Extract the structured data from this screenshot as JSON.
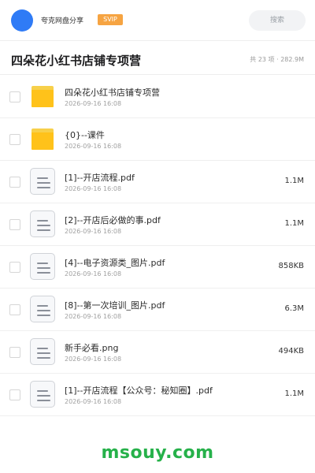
{
  "header": {
    "share_name": "夸克网盘分享",
    "badge": "SVIP",
    "search_placeholder": "搜索"
  },
  "folder": {
    "title": "四朵花小红书店铺专项营",
    "stats": "共 23 项 · 282.9M"
  },
  "files": [
    {
      "name": "四朵花小红书店铺专项营",
      "date": "2026-09-16 16:08",
      "size": "",
      "type": "folder"
    },
    {
      "name": "{0}--课件",
      "date": "2026-09-16 16:08",
      "size": "",
      "type": "folder"
    },
    {
      "name": "[1]--开店流程.pdf",
      "date": "2026-09-16 16:08",
      "size": "1.1M",
      "type": "file"
    },
    {
      "name": "[2]--开店后必做的事.pdf",
      "date": "2026-09-16 16:08",
      "size": "1.1M",
      "type": "file"
    },
    {
      "name": "[4]--电子资源类_图片.pdf",
      "date": "2026-09-16 16:08",
      "size": "858KB",
      "type": "file"
    },
    {
      "name": "[8]--第一次培训_图片.pdf",
      "date": "2026-09-16 16:08",
      "size": "6.3M",
      "type": "file"
    },
    {
      "name": "新手必看.png",
      "date": "2026-09-16 16:08",
      "size": "494KB",
      "type": "file"
    },
    {
      "name": "[1]--开店流程【公众号：秘知圈】.pdf",
      "date": "2026-09-16 16:08",
      "size": "1.1M",
      "type": "file"
    }
  ],
  "watermark": "msouy.com",
  "colors": {
    "avatar": "#2f7bf6",
    "badge": "#f6a442",
    "folder": "#ffc21a",
    "watermark": "#26b14a"
  }
}
